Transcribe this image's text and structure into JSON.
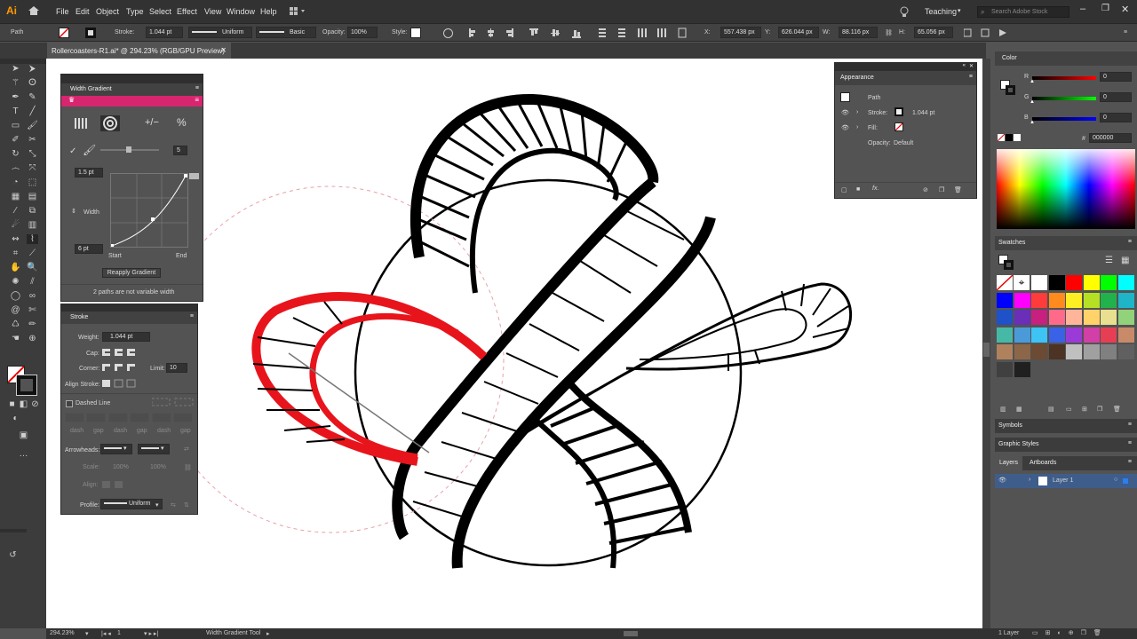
{
  "app": {
    "logo": "Ai"
  },
  "menu": [
    "File",
    "Edit",
    "Object",
    "Type",
    "Select",
    "Effect",
    "View",
    "Window",
    "Help"
  ],
  "workspace": "Teaching",
  "search": {
    "placeholder": "Search Adobe Stock"
  },
  "control": {
    "selection": "Path",
    "stroke_label": "Stroke:",
    "stroke_value": "1.044 pt",
    "profile": "Uniform",
    "brush": "Basic",
    "opacity_label": "Opacity:",
    "opacity_value": "100%",
    "style_label": "Style:",
    "x_label": "X:",
    "x_value": "557.438 px",
    "y_label": "Y:",
    "y_value": "626.044 px",
    "w_label": "W:",
    "w_value": "88.116 px",
    "h_label": "H:",
    "h_value": "65.056 px"
  },
  "document": {
    "tab_title": "Rollercoasters-R1.ai* @ 294.23% (RGB/GPU Preview)"
  },
  "width_gradient": {
    "title": "Width Gradient",
    "steps": "5",
    "start_width": "1.5 pt",
    "end_width": "6 pt",
    "width_label": "Width",
    "start_label": "Start",
    "end_label": "End",
    "reapply": "Reapply Gradient",
    "note": "2 paths are not variable width"
  },
  "stroke_panel": {
    "title": "Stroke",
    "weight_label": "Weight:",
    "weight_value": "1.044 pt",
    "cap_label": "Cap:",
    "corner_label": "Corner:",
    "limit_label": "Limit:",
    "limit_value": "10",
    "align_label": "Align Stroke:",
    "dashed_label": "Dashed Line",
    "dash_labels": [
      "dash",
      "gap",
      "dash",
      "gap",
      "dash",
      "gap"
    ],
    "arrowheads_label": "Arrowheads:",
    "scale_label": "Scale:",
    "scale_values": [
      "100%",
      "100%"
    ],
    "align_arrow_label": "Align:",
    "profile_label": "Profile:",
    "profile_value": "Uniform"
  },
  "appearance": {
    "title": "Appearance",
    "object": "Path",
    "stroke_label": "Stroke:",
    "stroke_value": "1.044 pt",
    "fill_label": "Fill:",
    "opacity_label": "Opacity:",
    "opacity_value": "Default"
  },
  "color_panel": {
    "title": "Color",
    "r_label": "R",
    "r_value": "0",
    "g_label": "G",
    "g_value": "0",
    "b_label": "B",
    "b_value": "0",
    "hex_prefix": "#",
    "hex_value": "000000"
  },
  "swatches": {
    "title": "Swatches",
    "colors": [
      "#ffffff",
      "#000000",
      "#ff0000",
      "#ffff00",
      "#00ff00",
      "#00ffff",
      "#0000ff",
      "#ff00ff",
      "#ff3b3b",
      "#ff8a1e",
      "#ffee22",
      "#b6e024",
      "#22b24c",
      "#1eb5c9",
      "#1f52c8",
      "#6a2eb8",
      "#c7207e",
      "#ff6a8a",
      "#ffb59a",
      "#ffd36a",
      "#e8e090",
      "#92d27a",
      "#45b9a6",
      "#4b9ad8",
      "#3ec3f5",
      "#3a62e6",
      "#9a3bd8",
      "#d23fa6",
      "#e63f55",
      "#c98a6a",
      "#b0815d",
      "#8c6648",
      "#6c4a33",
      "#4c3323",
      "#c0c0c0",
      "#a0a0a0",
      "#808080",
      "#606060",
      "#404040",
      "#202020"
    ]
  },
  "symbols": {
    "title": "Symbols"
  },
  "graphic_styles": {
    "title": "Graphic Styles"
  },
  "layers": {
    "tab1": "Layers",
    "tab2": "Artboards",
    "layer_name": "Layer 1",
    "count": "1 Layer"
  },
  "status": {
    "zoom": "294.23%",
    "artboard": "1",
    "tool": "Width Gradient Tool"
  },
  "accent": "#d8256f",
  "stroke_accent": "#e8141c"
}
